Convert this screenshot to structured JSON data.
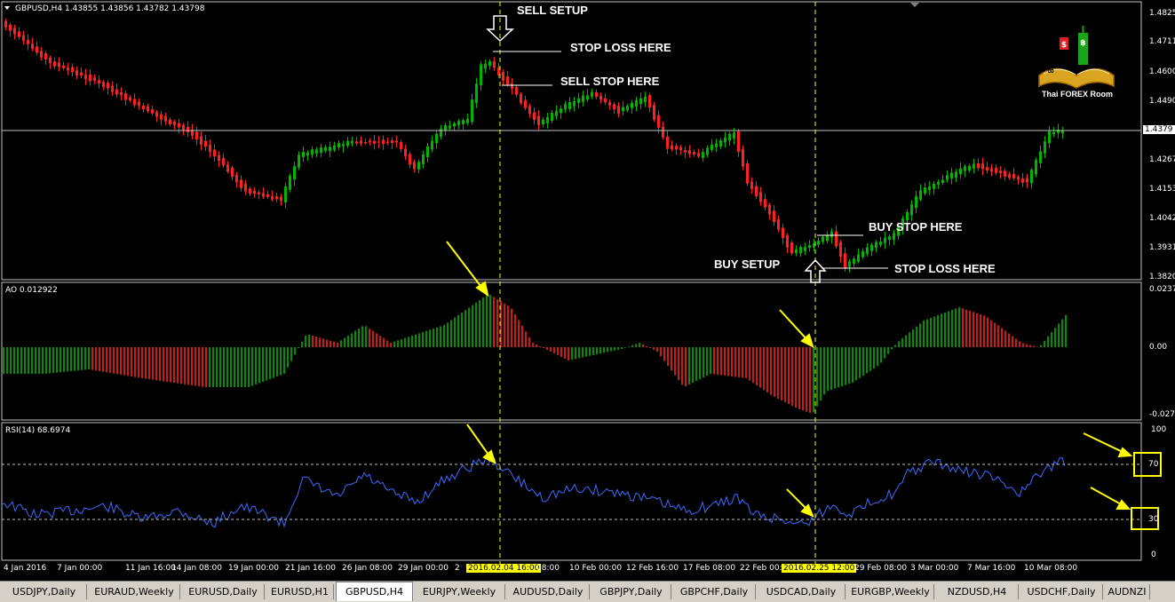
{
  "symbol_header": "GBPUSD,H4  1.43855 1.43856 1.43782 1.43798",
  "ao_header": "AO 0.012922",
  "rsi_header": "RSI(14) 68.6974",
  "annotations": {
    "sell_setup": "SELL SETUP",
    "stop_loss_top": "STOP LOSS HERE",
    "sell_stop": "SELL STOP HERE",
    "buy_stop": "BUY STOP HERE",
    "buy_setup": "BUY SETUP",
    "stop_loss_bottom": "STOP LOSS HERE"
  },
  "price_axis": [
    "1.4825",
    "1.4711",
    "1.4600",
    "1.4490",
    "1.4379",
    "1.4267",
    "1.4153",
    "1.4042",
    "1.3931",
    "1.3820"
  ],
  "current_price": "1.4379",
  "ao_axis": [
    "0.0237",
    "0.00",
    "-0.0270"
  ],
  "rsi_axis": [
    "100",
    "70",
    "30",
    "0"
  ],
  "rsi_levels": {
    "upper": "70",
    "lower": "30"
  },
  "time_axis": [
    "4 Jan 2016",
    "7 Jan 00:00",
    "11 Jan 16:00",
    "14 Jan 08:00",
    "19 Jan 00:00",
    "21 Jan 16:00",
    "26 Jan 08:00",
    "29 Jan 00:00",
    "2",
    "2016.02.04 16:00",
    "08:00",
    "10 Feb 00:00",
    "12 Feb 16:00",
    "17 Feb 08:00",
    "22 Feb 00:00",
    "2016.02.25 12:00",
    "29 Feb 08:00",
    "3 Mar 00:00",
    "7 Mar 16:00",
    "10 Mar 08:00"
  ],
  "logo_text": "Thai FOREX Room",
  "tabs": [
    "USDJPY,Daily",
    "EURAUD,Weekly",
    "EURUSD,Daily",
    "EURUSD,H1",
    "GBPUSD,H4",
    "EURJPY,Weekly",
    "AUDUSD,Daily",
    "GBPJPY,Daily",
    "GBPCHF,Daily",
    "USDCAD,Daily",
    "EURGBP,Weekly",
    "NZDUSD,H4",
    "USDCHF,Daily",
    "AUDNZI"
  ],
  "active_tab": "GBPUSD,H4",
  "colors": {
    "bull": "#00b400",
    "bear": "#ff2020",
    "rsi_line": "#3c6cff",
    "marker": "#ffff00",
    "grid": "#c0c0c0"
  }
}
